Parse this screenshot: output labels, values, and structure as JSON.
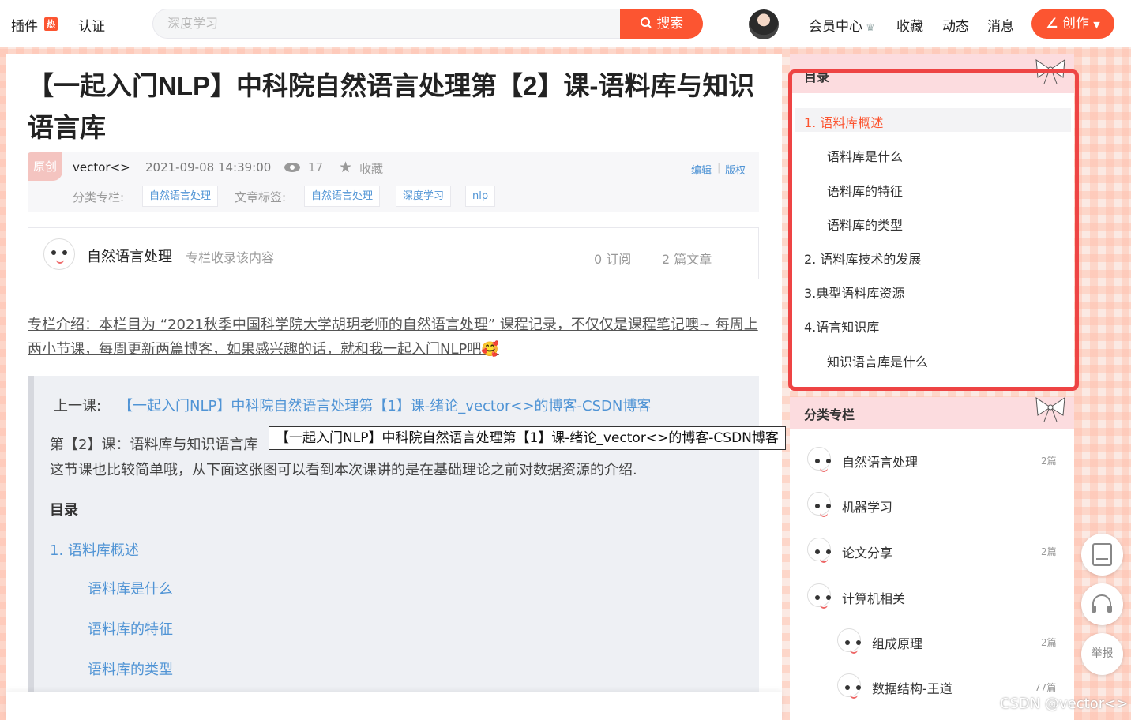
{
  "topbar": {
    "plugins_label": "插件",
    "hot_badge": "热",
    "auth_label": "认证",
    "search_placeholder": "深度学习",
    "search_button": "搜索",
    "member_center": "会员中心",
    "favorites": "收藏",
    "dynamics": "动态",
    "messages": "消息",
    "create_button": "创作"
  },
  "article": {
    "title": "【一起入门NLP】中科院自然语言处理第【2】课-语料库与知识语言库",
    "badge": "原创",
    "author": "vector<>",
    "datetime": "2021-09-08 14:39:00",
    "views": "17",
    "collect_label": "收藏",
    "edit_label": "编辑",
    "copyright_label": "版权",
    "category_label": "分类专栏:",
    "categories": [
      "自然语言处理"
    ],
    "tags_label": "文章标签:",
    "tags": [
      "自然语言处理",
      "深度学习",
      "nlp"
    ]
  },
  "column_card": {
    "name": "自然语言处理",
    "note": "专栏收录该内容",
    "subscriptions": "0 订阅",
    "articles": "2 篇文章"
  },
  "intro": {
    "text": "专栏介绍：本栏目为 “2021秋季中国科学院大学胡玥老师的自然语言处理” 课程记录，不仅仅是课程笔记噢~ 每周上两小节课，每周更新两篇博客，如果感兴趣的话，就和我一起入门NLP吧🥰"
  },
  "quote": {
    "prev_label": "上一课:",
    "prev_link": "【一起入门NLP】中科院自然语言处理第【1】课-绪论_vector<>的博客-CSDN博客",
    "lesson_line": "第【2】课：语料库与知识语言库",
    "desc": "这节课也比较简单哦，从下面这张图可以看到本次课讲的是在基础理论之前对数据资源的介绍.",
    "toc_heading": "目录",
    "toc": [
      "1. 语料库概述",
      "语料库是什么",
      "语料库的特征",
      "语料库的类型"
    ]
  },
  "tooltip": "【一起入门NLP】中科院自然语言处理第【1】课-绪论_vector<>的博客-CSDN博客",
  "sidebar_toc": {
    "heading": "目录",
    "items": [
      "1. 语料库概述",
      "语料库是什么",
      "语料库的特征",
      "语料库的类型",
      "2. 语料库技术的发展",
      "3.典型语料库资源",
      "4.语言知识库",
      "知识语言库是什么"
    ]
  },
  "sidebar_categories": {
    "heading": "分类专栏",
    "items": [
      {
        "name": "自然语言处理",
        "count": "2篇"
      },
      {
        "name": "机器学习",
        "count": ""
      },
      {
        "name": "论文分享",
        "count": "2篇"
      },
      {
        "name": "计算机相关",
        "count": ""
      },
      {
        "name": "组成原理",
        "count": "2篇"
      },
      {
        "name": "数据结构-王道",
        "count": "77篇"
      }
    ]
  },
  "side_buttons": {
    "report": "举报"
  },
  "watermark": "CSDN @vector<>",
  "colors": {
    "accent": "#fc5531",
    "link": "#5094d5",
    "highlight_border": "#ee4444",
    "sidebar_header": "#fcdcdf"
  }
}
